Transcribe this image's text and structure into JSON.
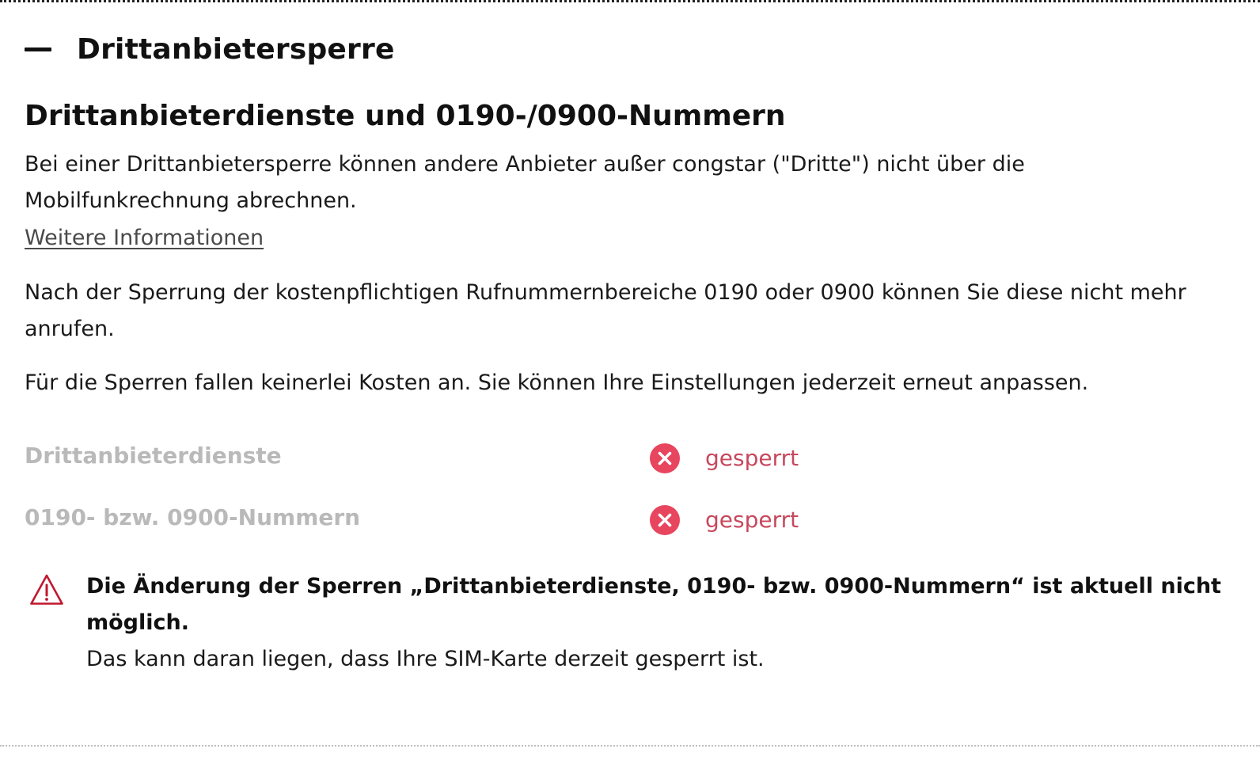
{
  "accordion": {
    "title": "Drittanbietersperre"
  },
  "section": {
    "heading": "Drittanbieterdienste und 0190-/0900-Nummern",
    "paragraph1": "Bei einer Drittanbietersperre können andere Anbieter außer congstar (\"Dritte\") nicht über die Mobilfunkrechnung abrechnen.",
    "more_link": "Weitere Informationen",
    "paragraph2": "Nach der Sperrung der kostenpflichtigen Rufnummernbereiche 0190 oder 0900 können Sie diese nicht mehr anrufen.",
    "paragraph3": "Für die Sperren fallen keinerlei Kosten an. Sie können Ihre Einstellungen jederzeit erneut anpassen."
  },
  "blocks": [
    {
      "label": "Drittanbieterdienste",
      "status": "gesperrt",
      "icon": "blocked-x-circle-icon"
    },
    {
      "label": "0190- bzw. 0900-Nummern",
      "status": "gesperrt",
      "icon": "blocked-x-circle-icon"
    }
  ],
  "warning": {
    "icon": "warning-triangle-icon",
    "title": "Die Änderung der Sperren „Drittanbieterdienste, 0190- bzw. 0900-Nummern“ ist aktuell nicht möglich.",
    "text": "Das kann daran liegen, dass Ihre SIM-Karte derzeit gesperrt ist."
  },
  "colors": {
    "status_red": "#e8455f",
    "status_text": "#c7485d",
    "disabled_label": "#b9b9b9",
    "warning_red": "#c0182e"
  }
}
